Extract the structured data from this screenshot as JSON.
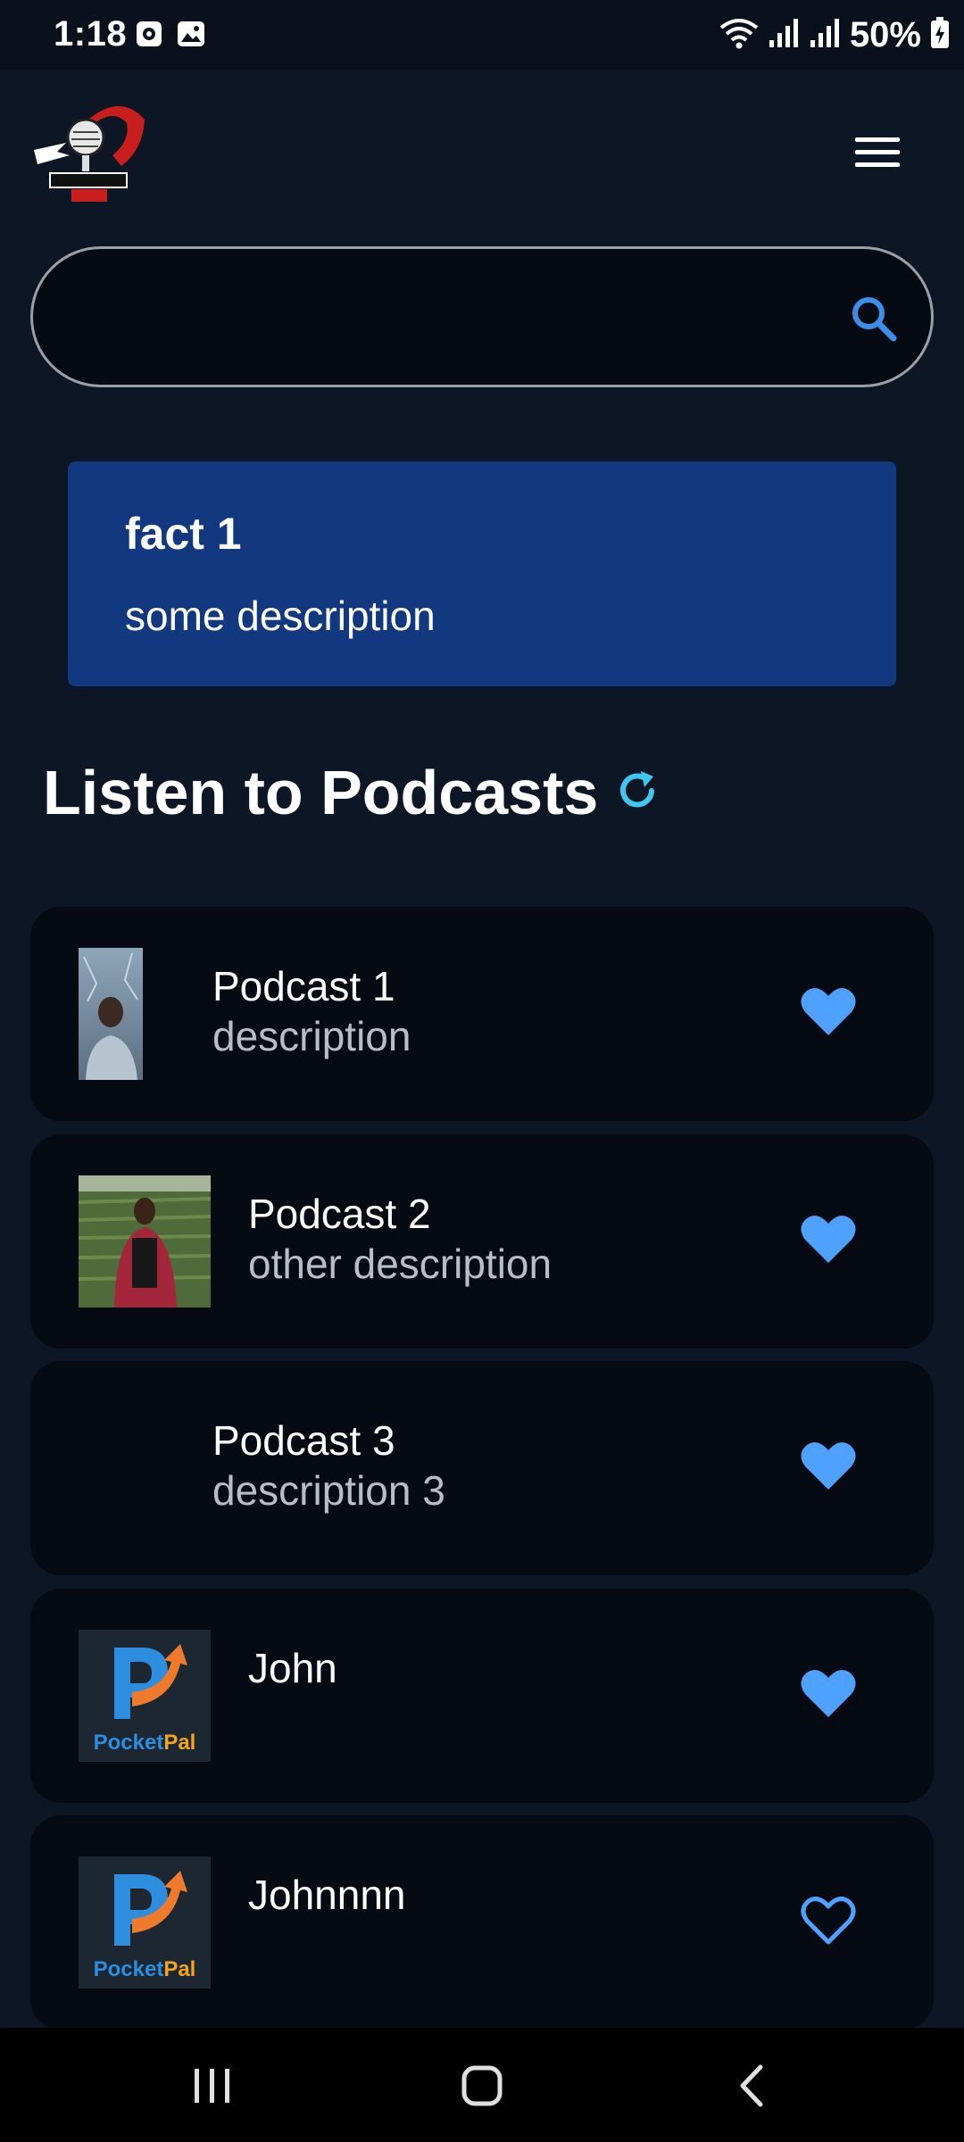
{
  "status_bar": {
    "time": "1:18",
    "battery": "50%",
    "icons": [
      "media-icon",
      "gallery-icon",
      "wifi-icon",
      "signal-icon",
      "signal-icon",
      "battery-charging-icon"
    ]
  },
  "header": {
    "logo_icon": "microphone-logo",
    "menu_icon": "hamburger-menu-icon"
  },
  "search": {
    "placeholder": "",
    "value": "",
    "icon": "search-icon"
  },
  "fact": {
    "title": "fact 1",
    "description": "some description"
  },
  "section": {
    "title": "Listen to Podcasts",
    "refresh_icon": "refresh-icon"
  },
  "podcasts": [
    {
      "title": "Podcast 1",
      "description": "description",
      "thumb": "portrait-photo",
      "favorited": true
    },
    {
      "title": "Podcast 2",
      "description": "other description",
      "thumb": "portrait-photo",
      "favorited": true
    },
    {
      "title": "Podcast 3",
      "description": "description 3",
      "thumb": "none",
      "favorited": true
    },
    {
      "title": "John",
      "description": "",
      "thumb": "pocketpal-logo",
      "thumb_text": "PocketPal",
      "favorited": true
    },
    {
      "title": "Johnnnn",
      "description": "",
      "thumb": "pocketpal-logo",
      "thumb_text": "PocketPal",
      "favorited": false
    }
  ],
  "colors": {
    "background": "#0d1625",
    "card": "#060a12",
    "fact_card": "#12387f",
    "accent": "#4ea1ff",
    "refresh": "#3ec7f0"
  },
  "nav": {
    "icons": [
      "recent-apps-icon",
      "home-icon",
      "back-icon"
    ]
  }
}
